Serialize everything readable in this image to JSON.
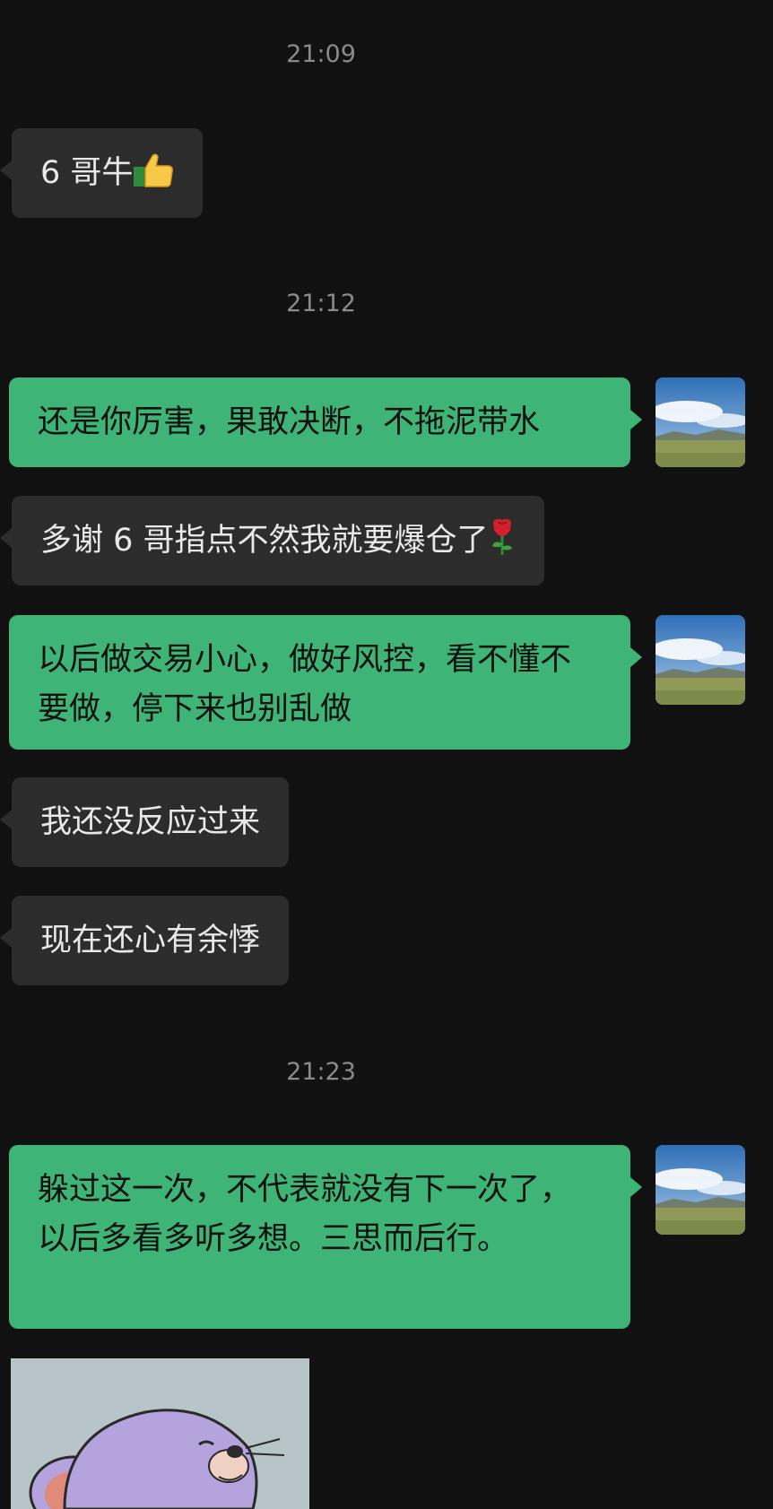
{
  "messages": {
    "time1": "21:09",
    "m1": "6 哥牛",
    "time2": "21:12",
    "m2": "还是你厉害，果敢决断，不拖泥带水",
    "m3": "多谢 6 哥指点不然我就要爆仓了",
    "m4": "以后做交易小心，做好风控，看不懂不要做，停下来也别乱做",
    "m5": "我还没反应过来",
    "m6": "现在还心有余悸",
    "time3": "21:23",
    "m7": "躲过这一次，不代表就没有下一次了，以后多看多听多想。三思而后行。"
  },
  "icons": {
    "m1_emoji": "thumbs-up-icon",
    "m3_emoji": "rose-icon",
    "avatar": "landscape-avatar",
    "sticker": "cartoon-mouse-sticker"
  },
  "colors": {
    "background": "#111111",
    "incoming_bubble": "#2c2c2c",
    "outgoing_bubble": "#3eb476",
    "timestamp": "#8a8a8a"
  }
}
